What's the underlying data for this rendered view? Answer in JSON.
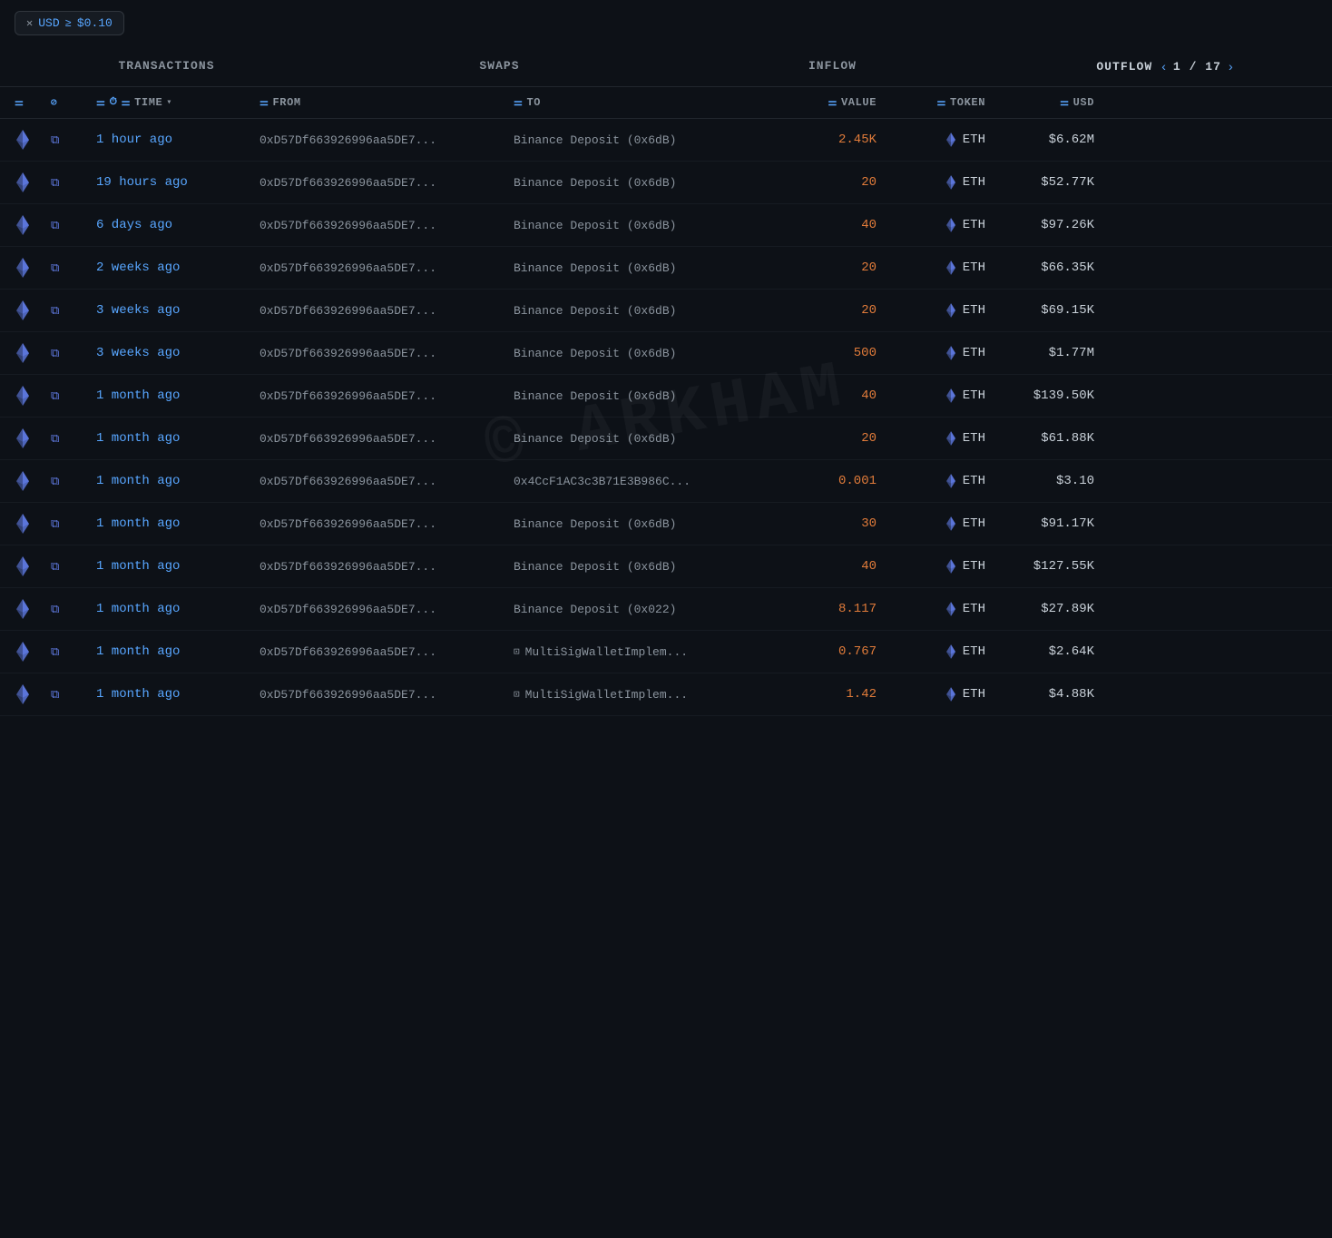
{
  "filter": {
    "currency": "USD",
    "operator": "≥",
    "value": "$0.10"
  },
  "tabs": [
    {
      "id": "transactions",
      "label": "TRANSACTIONS",
      "active": false
    },
    {
      "id": "swaps",
      "label": "SWAPS",
      "active": false
    },
    {
      "id": "inflow",
      "label": "INFLOW",
      "active": false
    },
    {
      "id": "outflow",
      "label": "OUTFLOW",
      "active": true
    }
  ],
  "pagination": {
    "current": "1",
    "total": "17"
  },
  "columns": [
    {
      "id": "chain",
      "label": ""
    },
    {
      "id": "link",
      "label": ""
    },
    {
      "id": "time",
      "label": "TIME",
      "filterable": true,
      "sortable": true
    },
    {
      "id": "from",
      "label": "FROM",
      "filterable": true
    },
    {
      "id": "to",
      "label": "TO",
      "filterable": true
    },
    {
      "id": "value",
      "label": "VALUE",
      "filterable": true
    },
    {
      "id": "token",
      "label": "TOKEN",
      "filterable": true
    },
    {
      "id": "usd",
      "label": "USD",
      "filterable": true
    }
  ],
  "rows": [
    {
      "time": "1 hour ago",
      "from": "0xD57Df663926996aa5DE7...",
      "to": "Binance Deposit (0x6dB)",
      "to_type": "address",
      "value": "2.45K",
      "token": "ETH",
      "usd": "$6.62M"
    },
    {
      "time": "19 hours ago",
      "from": "0xD57Df663926996aa5DE7...",
      "to": "Binance Deposit (0x6dB)",
      "to_type": "address",
      "value": "20",
      "token": "ETH",
      "usd": "$52.77K"
    },
    {
      "time": "6 days ago",
      "from": "0xD57Df663926996aa5DE7...",
      "to": "Binance Deposit (0x6dB)",
      "to_type": "address",
      "value": "40",
      "token": "ETH",
      "usd": "$97.26K"
    },
    {
      "time": "2 weeks ago",
      "from": "0xD57Df663926996aa5DE7...",
      "to": "Binance Deposit (0x6dB)",
      "to_type": "address",
      "value": "20",
      "token": "ETH",
      "usd": "$66.35K"
    },
    {
      "time": "3 weeks ago",
      "from": "0xD57Df663926996aa5DE7...",
      "to": "Binance Deposit (0x6dB)",
      "to_type": "address",
      "value": "20",
      "token": "ETH",
      "usd": "$69.15K"
    },
    {
      "time": "3 weeks ago",
      "from": "0xD57Df663926996aa5DE7...",
      "to": "Binance Deposit (0x6dB)",
      "to_type": "address",
      "value": "500",
      "token": "ETH",
      "usd": "$1.77M"
    },
    {
      "time": "1 month ago",
      "from": "0xD57Df663926996aa5DE7...",
      "to": "Binance Deposit (0x6dB)",
      "to_type": "address",
      "value": "40",
      "token": "ETH",
      "usd": "$139.50K"
    },
    {
      "time": "1 month ago",
      "from": "0xD57Df663926996aa5DE7...",
      "to": "Binance Deposit (0x6dB)",
      "to_type": "address",
      "value": "20",
      "token": "ETH",
      "usd": "$61.88K"
    },
    {
      "time": "1 month ago",
      "from": "0xD57Df663926996aa5DE7...",
      "to": "0x4CcF1AC3c3B71E3B986C...",
      "to_type": "address",
      "value": "0.001",
      "token": "ETH",
      "usd": "$3.10"
    },
    {
      "time": "1 month ago",
      "from": "0xD57Df663926996aa5DE7...",
      "to": "Binance Deposit (0x6dB)",
      "to_type": "address",
      "value": "30",
      "token": "ETH",
      "usd": "$91.17K"
    },
    {
      "time": "1 month ago",
      "from": "0xD57Df663926996aa5DE7...",
      "to": "Binance Deposit (0x6dB)",
      "to_type": "address",
      "value": "40",
      "token": "ETH",
      "usd": "$127.55K"
    },
    {
      "time": "1 month ago",
      "from": "0xD57Df663926996aa5DE7...",
      "to": "Binance Deposit (0x022)",
      "to_type": "address",
      "value": "8.117",
      "token": "ETH",
      "usd": "$27.89K"
    },
    {
      "time": "1 month ago",
      "from": "0xD57Df663926996aa5DE7...",
      "to": "MultiSigWalletImplem...",
      "to_type": "contract",
      "value": "0.767",
      "token": "ETH",
      "usd": "$2.64K"
    },
    {
      "time": "1 month ago",
      "from": "0xD57Df663926996aa5DE7...",
      "to": "MultiSigWalletImplem...",
      "to_type": "contract",
      "value": "1.42",
      "token": "ETH",
      "usd": "$4.88K"
    }
  ],
  "watermark": "© ARKHAM"
}
